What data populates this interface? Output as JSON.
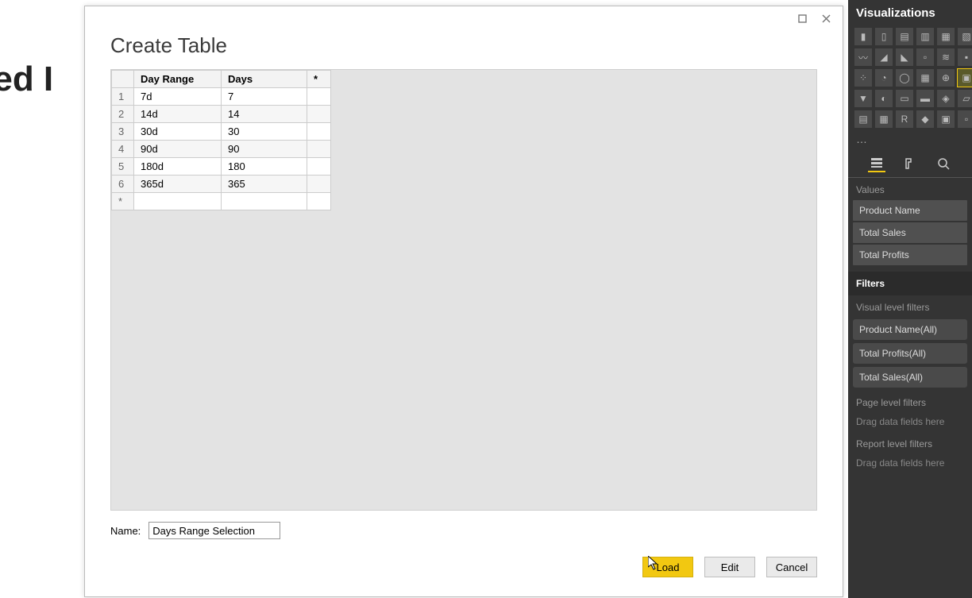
{
  "background_text": "aded I",
  "dialog": {
    "title": "Create Table",
    "columns": [
      "Day Range",
      "Days",
      "*"
    ],
    "rows": [
      {
        "n": "1",
        "range": "7d",
        "days": "7"
      },
      {
        "n": "2",
        "range": "14d",
        "days": "14"
      },
      {
        "n": "3",
        "range": "30d",
        "days": "30"
      },
      {
        "n": "4",
        "range": "90d",
        "days": "90"
      },
      {
        "n": "5",
        "range": "180d",
        "days": "180"
      },
      {
        "n": "6",
        "range": "365d",
        "days": "365"
      }
    ],
    "name_label": "Name:",
    "name_value": "Days Range Selection",
    "buttons": {
      "load": "Load",
      "edit": "Edit",
      "cancel": "Cancel"
    }
  },
  "viz_panel": {
    "title": "Visualizations",
    "values_label": "Values",
    "values": [
      "Product Name",
      "Total Sales",
      "Total Profits"
    ],
    "filters_title": "Filters",
    "visual_filters_label": "Visual level filters",
    "visual_filters": [
      "Product Name(All)",
      "Total Profits(All)",
      "Total Sales(All)"
    ],
    "page_filters_label": "Page level filters",
    "page_filters_hint": "Drag data fields here",
    "report_filters_label": "Report level filters",
    "report_filters_hint": "Drag data fields here"
  }
}
